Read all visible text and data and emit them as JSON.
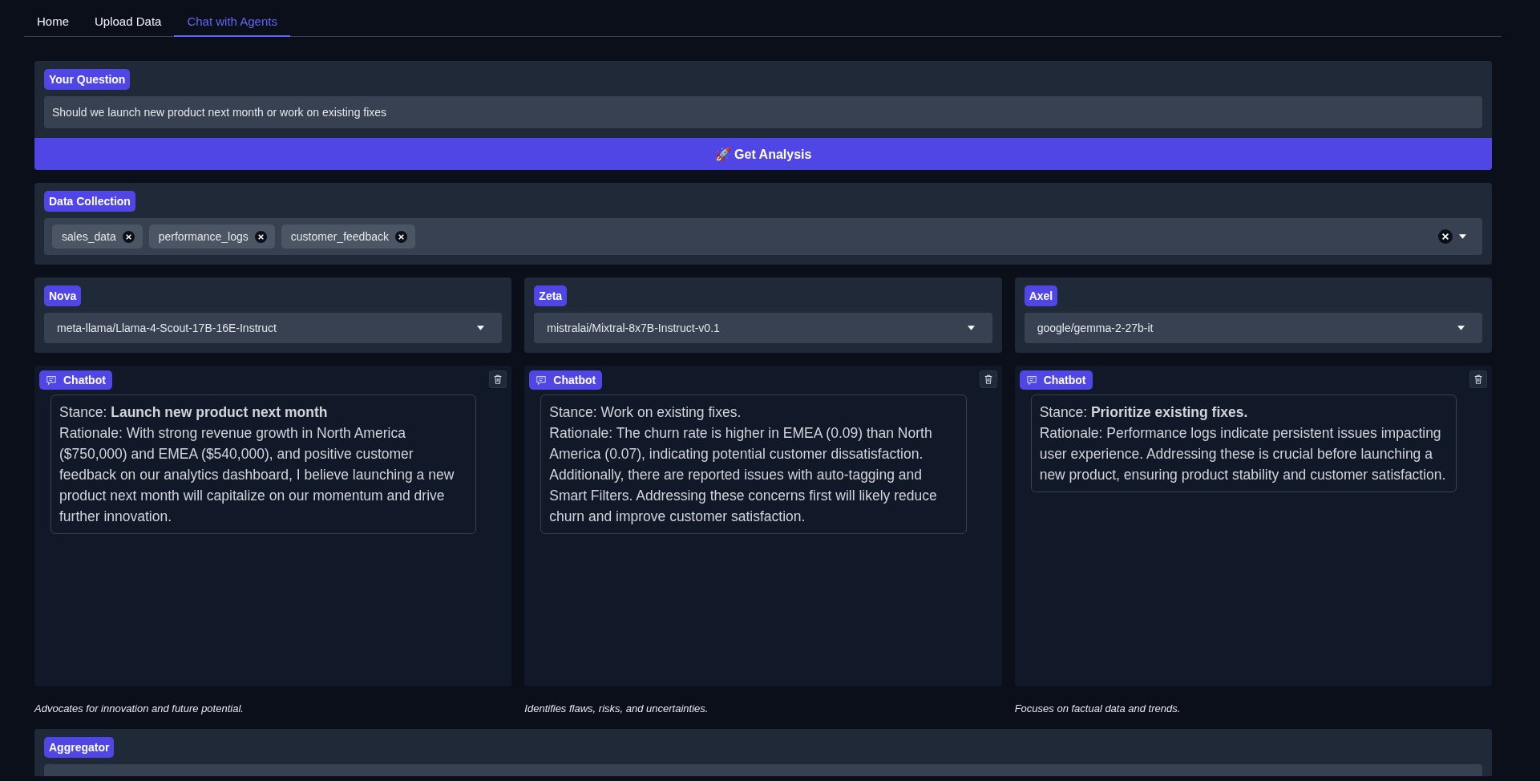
{
  "tabs": [
    {
      "label": "Home",
      "selected": false
    },
    {
      "label": "Upload Data",
      "selected": false
    },
    {
      "label": "Chat with Agents",
      "selected": true
    }
  ],
  "question": {
    "label": "Your Question",
    "value": "Should we launch new product next month or work on existing fixes"
  },
  "analyze_button": {
    "icon": "🚀",
    "label": "Get Analysis"
  },
  "data_collection": {
    "label": "Data Collection",
    "chips": [
      "sales_data",
      "performance_logs",
      "customer_feedback"
    ]
  },
  "agents": [
    {
      "name": "Nova",
      "model": "meta-llama/Llama-4-Scout-17B-16E-Instruct",
      "chatbot_label": "Chatbot",
      "message": "Stance: **Launch new product next month**\nRationale: With strong revenue growth in North America ($750,000) and EMEA ($540,000), and positive customer feedback on our analytics dashboard, I believe launching a new product next month will capitalize on our momentum and drive further innovation.",
      "caption": "Advocates for innovation and future potential."
    },
    {
      "name": "Zeta",
      "model": "mistralai/Mixtral-8x7B-Instruct-v0.1",
      "chatbot_label": "Chatbot",
      "message": "Stance: Work on existing fixes.\nRationale: The churn rate is higher in EMEA (0.09) than North America (0.07), indicating potential customer dissatisfaction. Additionally, there are reported issues with auto-tagging and Smart Filters. Addressing these concerns first will likely reduce churn and improve customer satisfaction.",
      "caption": "Identifies flaws, risks, and uncertainties."
    },
    {
      "name": "Axel",
      "model": "google/gemma-2-27b-it",
      "chatbot_label": "Chatbot",
      "message": "Stance: **Prioritize existing fixes.**\nRationale: Performance logs indicate persistent issues impacting user experience. Addressing these is crucial before launching a new product, ensuring product stability and customer satisfaction.",
      "caption": "Focuses on factual data and trends."
    }
  ],
  "aggregator": {
    "label": "Aggregator"
  }
}
